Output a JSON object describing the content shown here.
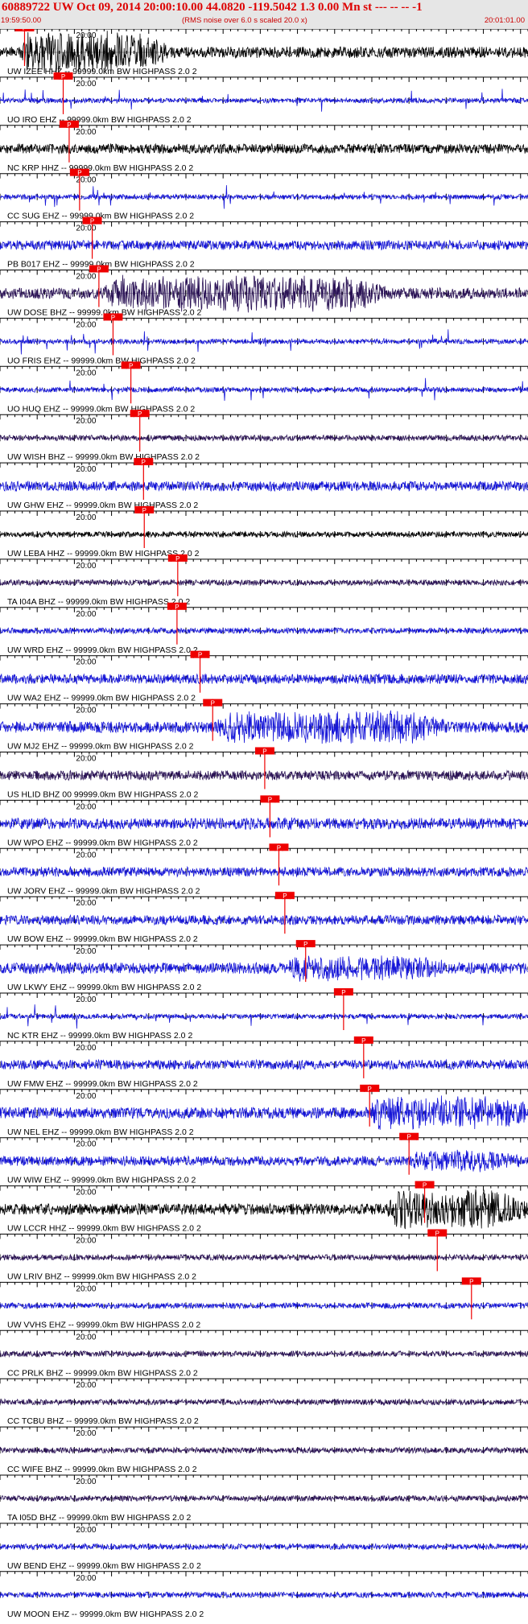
{
  "header": {
    "title": "60889722 UW Oct 09, 2014 20:00:10.00   44.0820 -119.5042  1.3 0.00 Mn st --- -- --  -1",
    "subtitle": "(RMS noise over 6.0 s scaled 20.0 x)",
    "start_time": "19:59:50.00",
    "end_time": "20:01:01.00"
  },
  "chart_data": {
    "type": "line",
    "title": "60889722 UW Oct 09, 2014 20:00:10.00   44.0820 -119.5042  1.3 0.00 Mn st --- -- --  -1",
    "time_start_label": "19:59:50.00",
    "time_end_label": "20:01:01.00",
    "time_window_s": 71,
    "minute_mark_label": "20:00",
    "pick_label": "P",
    "colors": {
      "trace_blue": "#1515d8",
      "trace_dark": "#2a1255",
      "trace_black": "#000000",
      "pick": "#ee0000",
      "grid": "#000000"
    },
    "series": [
      {
        "name": "UW IZEE HHZ -- 99999.0km BW  HIGHPASS  2.0  2",
        "color": "#000000",
        "pick_s": 3.3,
        "amplitude": "high",
        "burst": [
          2.5,
          22.5,
          28
        ]
      },
      {
        "name": "UO IRO EHZ -- 99999.0km BW  HIGHPASS  2.0  2",
        "color": "#1515d8",
        "pick_s": 8.5,
        "amplitude": "spiky"
      },
      {
        "name": "NC KRP HHZ -- 99999.0km BW  HIGHPASS  2.0  2",
        "color": "#000000",
        "pick_s": 9.3,
        "amplitude": "medium"
      },
      {
        "name": "CC SUG EHZ -- 99999.0km BW  HIGHPASS  2.0  2",
        "color": "#1515d8",
        "pick_s": 10.7,
        "amplitude": "spiky"
      },
      {
        "name": "PB B017 EHZ -- 99999.0km BW  HIGHPASS  2.0  2",
        "color": "#1515d8",
        "pick_s": 12.4,
        "amplitude": "medium"
      },
      {
        "name": "UW DOSE BHZ -- 99999.0km BW  HIGHPASS  2.0  2",
        "color": "#2a1255",
        "pick_s": 13.3,
        "amplitude": "high",
        "burst": [
          14,
          52,
          24
        ]
      },
      {
        "name": "UO FRIS EHZ -- 99999.0km BW  HIGHPASS  2.0  2",
        "color": "#1515d8",
        "pick_s": 15.2,
        "amplitude": "spiky"
      },
      {
        "name": "UO HUQ EHZ -- 99999.0km BW  HIGHPASS  2.0  2",
        "color": "#1515d8",
        "pick_s": 17.6,
        "amplitude": "spiky"
      },
      {
        "name": "UW WISH BHZ -- 99999.0km BW  HIGHPASS  2.0  2",
        "color": "#2a1255",
        "pick_s": 18.8,
        "amplitude": "low"
      },
      {
        "name": "UW GHW EHZ -- 99999.0km BW  HIGHPASS  2.0  2",
        "color": "#1515d8",
        "pick_s": 19.3,
        "amplitude": "medium"
      },
      {
        "name": "UW LEBA HHZ -- 99999.0km BW  HIGHPASS  2.0  2",
        "color": "#000000",
        "pick_s": 19.4,
        "amplitude": "low"
      },
      {
        "name": "TA I04A BHZ -- 99999.0km BW  HIGHPASS  2.0  2",
        "color": "#2a1255",
        "pick_s": 23.9,
        "amplitude": "low"
      },
      {
        "name": "UW WRD EHZ -- 99999.0km BW  HIGHPASS  2.0  2",
        "color": "#1515d8",
        "pick_s": 23.8,
        "amplitude": "low"
      },
      {
        "name": "UW WA2 EHZ -- 99999.0km BW  HIGHPASS  2.0  2",
        "color": "#1515d8",
        "pick_s": 26.9,
        "amplitude": "medium"
      },
      {
        "name": "UW MJ2 EHZ -- 99999.0km BW  HIGHPASS  2.0  2",
        "color": "#1515d8",
        "pick_s": 28.6,
        "amplitude": "high",
        "burst": [
          29,
          60,
          22
        ]
      },
      {
        "name": "US HLID BHZ 00 99999.0km BW  HIGHPASS  2.0  2",
        "color": "#2a1255",
        "pick_s": 35.6,
        "amplitude": "medium"
      },
      {
        "name": "UW WPO EHZ -- 99999.0km BW  HIGHPASS  2.0  2",
        "color": "#1515d8",
        "pick_s": 36.3,
        "amplitude": "high",
        "burst": [
          36.5,
          40,
          10
        ]
      },
      {
        "name": "UW JORV EHZ -- 99999.0km BW  HIGHPASS  2.0  2",
        "color": "#1515d8",
        "pick_s": 37.5,
        "amplitude": "medium"
      },
      {
        "name": "UW BOW EHZ -- 99999.0km BW  HIGHPASS  2.0  2",
        "color": "#1515d8",
        "pick_s": 38.3,
        "amplitude": "medium"
      },
      {
        "name": "UW LKWY EHZ -- 99999.0km BW  HIGHPASS  2.0  2",
        "color": "#1515d8",
        "pick_s": 41.1,
        "amplitude": "high",
        "burst": [
          38.5,
          60,
          17
        ]
      },
      {
        "name": "NC KTR EHZ -- 99999.0km BW  HIGHPASS  2.0  2",
        "color": "#1515d8",
        "pick_s": 46.2,
        "amplitude": "spiky"
      },
      {
        "name": "UW FMW EHZ -- 99999.0km BW  HIGHPASS  2.0  2",
        "color": "#1515d8",
        "pick_s": 48.9,
        "amplitude": "medium"
      },
      {
        "name": "UW NEL EHZ -- 99999.0km BW  HIGHPASS  2.0  2",
        "color": "#1515d8",
        "pick_s": 49.7,
        "amplitude": "high",
        "burst": [
          49.5,
          72,
          22
        ]
      },
      {
        "name": "UW WIW EHZ -- 99999.0km BW  HIGHPASS  2.0  2",
        "color": "#1515d8",
        "pick_s": 55.0,
        "amplitude": "medium",
        "burst": [
          55,
          70,
          14
        ]
      },
      {
        "name": "UW LCCR HHZ -- 99999.0km BW  HIGHPASS  2.0  2",
        "color": "#000000",
        "pick_s": 57.1,
        "amplitude": "high",
        "burst": [
          52,
          71,
          27
        ]
      },
      {
        "name": "UW LRIV BHZ -- 99999.0km BW  HIGHPASS  2.0  2",
        "color": "#2a1255",
        "pick_s": 58.8,
        "amplitude": "low"
      },
      {
        "name": "UW VVHS EHZ -- 99999.0km BW  HIGHPASS  2.0  2",
        "color": "#1515d8",
        "pick_s": 63.4,
        "amplitude": "low"
      },
      {
        "name": "CC PRLK BHZ -- 99999.0km BW  HIGHPASS  2.0  2",
        "color": "#2a1255",
        "amplitude": "low"
      },
      {
        "name": "CC TCBU BHZ -- 99999.0km BW  HIGHPASS  2.0  2",
        "color": "#2a1255",
        "amplitude": "low"
      },
      {
        "name": "CC WIFE BHZ -- 99999.0km BW  HIGHPASS  2.0  2",
        "color": "#2a1255",
        "amplitude": "low"
      },
      {
        "name": "TA I05D BHZ -- 99999.0km BW  HIGHPASS  2.0  2",
        "color": "#2a1255",
        "amplitude": "low"
      },
      {
        "name": "UW BEND EHZ -- 99999.0km BW  HIGHPASS  2.0  2",
        "color": "#1515d8",
        "amplitude": "low"
      },
      {
        "name": "UW MOON EHZ -- 99999.0km BW  HIGHPASS  2.0  2",
        "color": "#1515d8",
        "amplitude": "low"
      }
    ]
  }
}
